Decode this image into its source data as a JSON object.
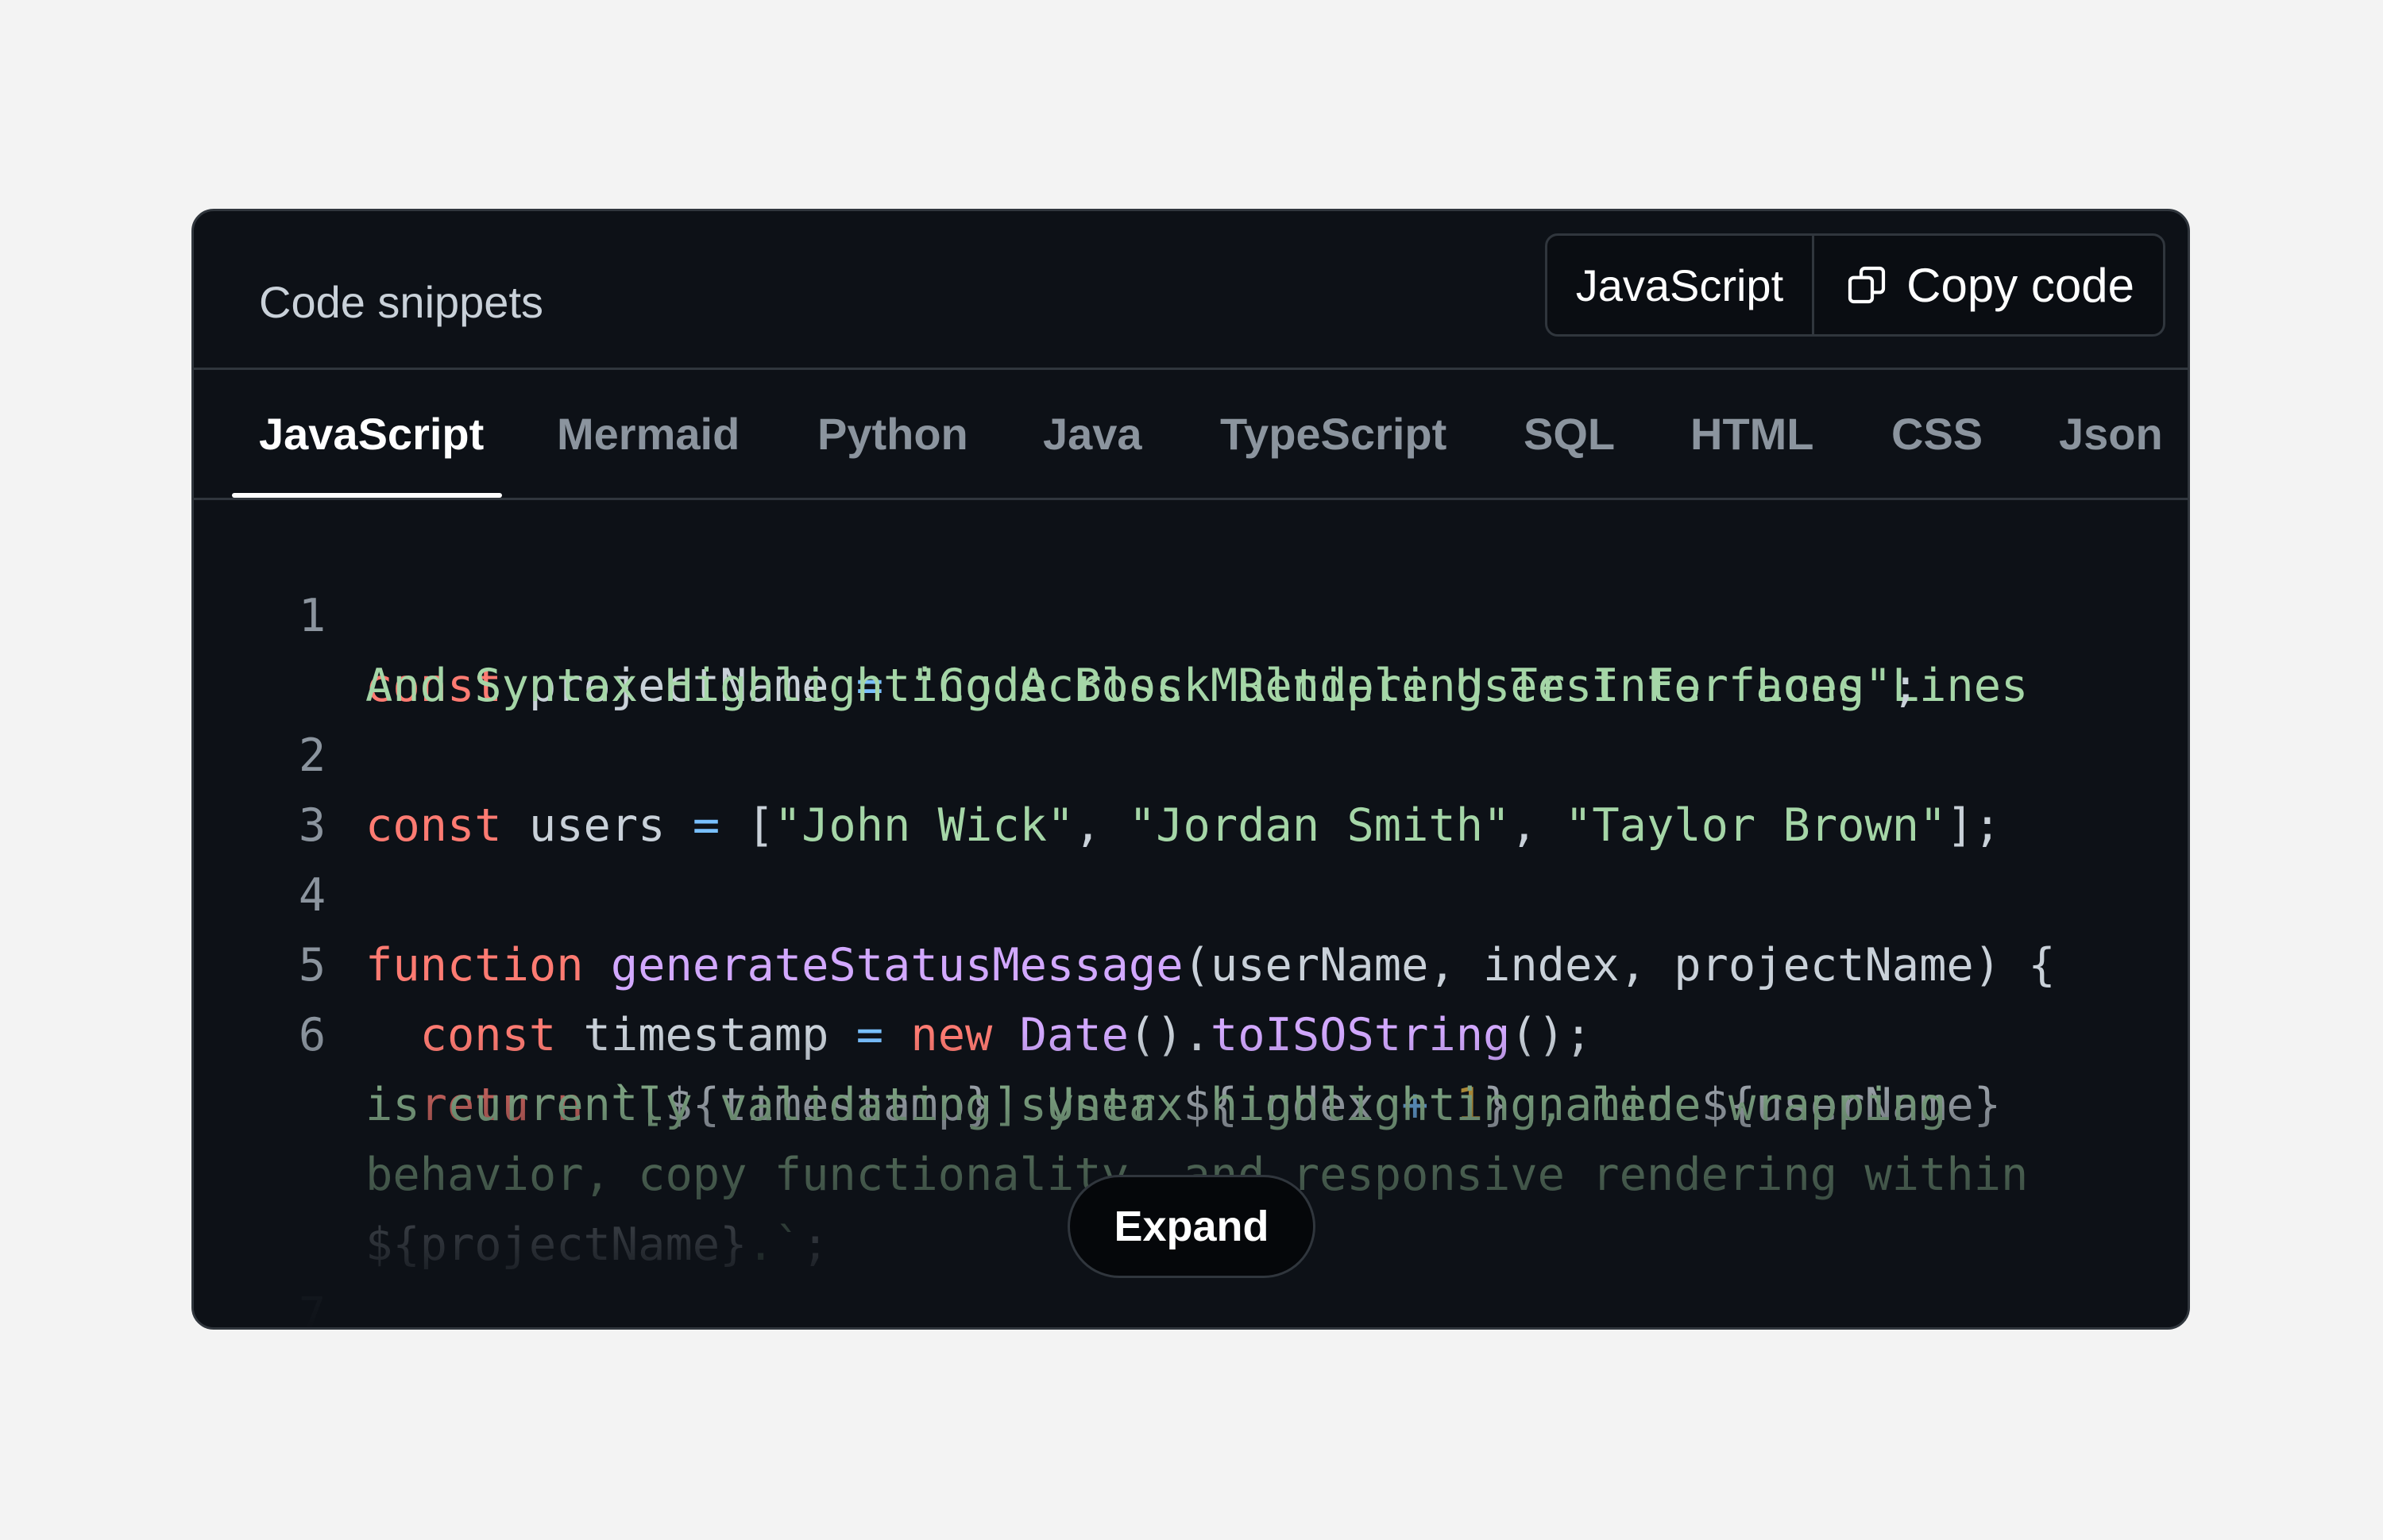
{
  "header": {
    "title": "Code snippets",
    "language_button": "JavaScript",
    "copy_button": "Copy code"
  },
  "tabs": [
    {
      "label": "JavaScript",
      "active": true
    },
    {
      "label": "Mermaid",
      "active": false
    },
    {
      "label": "Python",
      "active": false
    },
    {
      "label": "Java",
      "active": false
    },
    {
      "label": "TypeScript",
      "active": false
    },
    {
      "label": "SQL",
      "active": false
    },
    {
      "label": "HTML",
      "active": false
    },
    {
      "label": "CSS",
      "active": false
    },
    {
      "label": "Json",
      "active": false
    }
  ],
  "code": {
    "line_numbers": [
      "1",
      "2",
      "3",
      "4",
      "5",
      "6",
      "7"
    ],
    "l1": {
      "kw": "const",
      "name": " projectName ",
      "eq": "=",
      "str_a": " \"Code Block Rendering Test For Long Lines",
      "str_b": "And Syntax Highlighting Across Multiple User Interfaces\"",
      "end": ";"
    },
    "l2": {
      "kw": "const",
      "name": " users ",
      "eq": "=",
      "open": " [",
      "s1": "\"John Wick\"",
      "c1": ", ",
      "s2": "\"Jordan Smith\"",
      "c2": ", ",
      "s3": "\"Taylor Brown\"",
      "end": "];"
    },
    "l4": {
      "kw": "function",
      "fn": " generateStatusMessage",
      "params": "(userName, index, projectName) {"
    },
    "l5": {
      "indent": "  ",
      "kw": "const",
      "name": " timestamp ",
      "eq": "=",
      "new": " new",
      "cls": " Date",
      "mid": "().",
      "method": "toISOString",
      "end": "();"
    },
    "l6": {
      "indent": "  ",
      "kw": "return",
      "sa": " `[",
      "ia": "${timestamp}",
      "sb": "] User ",
      "ib": "${index",
      "plus": " +",
      "one": " 1",
      "ibc": "}",
      "sc": " named ",
      "ic": "${userName}",
      "w1": "is currently validating syntax highlighting, line wrapping",
      "w2": "behavior, copy functionality, and responsive rendering within",
      "w3a": "${projectName}",
      "w3b": ".`",
      "w3c": ";"
    },
    "l7": {
      "close": "}"
    }
  },
  "expand_button": "Expand",
  "colors": {
    "background": "#0d1117",
    "keyword": "#ff7b72",
    "function": "#d2a8ff",
    "string": "#a5d6a7",
    "operator": "#79c0ff",
    "number": "#e3b341"
  }
}
